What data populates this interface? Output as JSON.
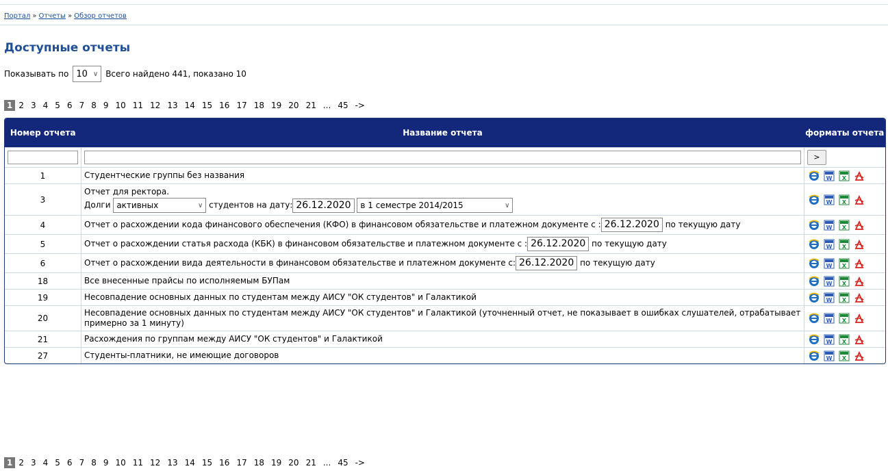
{
  "breadcrumb": [
    "Портал",
    "Отчеты",
    "Обзор отчетов"
  ],
  "breadcrumb_sep": "»",
  "page_title": "Доступные отчеты",
  "show_label": "Показывать по",
  "page_size": "10",
  "total_text": "Всего найдено 441, показано 10",
  "pager": {
    "current": "1",
    "pages": [
      "2",
      "3",
      "4",
      "5",
      "6",
      "7",
      "8",
      "9",
      "10",
      "11",
      "12",
      "13",
      "14",
      "15",
      "16",
      "17",
      "18",
      "19",
      "20",
      "21"
    ],
    "ellipsis": "...",
    "last": "45",
    "next": "->"
  },
  "table": {
    "headers": {
      "num": "Номер отчета",
      "name": "Название отчета",
      "formats": "форматы отчета"
    },
    "filter_go": ">",
    "rows": [
      {
        "num": "1",
        "name": "Студентческие группы без названия"
      },
      {
        "num": "3",
        "line1": "Отчет для ректора.",
        "pre": "Долги",
        "status": "активных",
        "mid": "студентов на дату:",
        "date": "26.12.2020",
        "semester": "в 1 семестре 2014/2015"
      },
      {
        "num": "4",
        "pre": "Отчет о расхождении кода финансового обеспечения (КФО) в финансовом обязательстве и платежном документе с :",
        "date": "26.12.2020",
        "post": "по текущую дату"
      },
      {
        "num": "5",
        "pre": "Отчет о расхождении статья расхода (КБК) в финансовом обязательстве и платежном документе с :",
        "date": "26.12.2020",
        "post": "по текущую дату"
      },
      {
        "num": "6",
        "pre": "Отчет о расхождении вида деятельности в финансовом обязательстве и платежном документе с:",
        "date": "26.12.2020",
        "post": "по текущую дату"
      },
      {
        "num": "18",
        "name": "Все внесенные прайсы по исполняемым БУПам"
      },
      {
        "num": "19",
        "name": "Несовпадение основных данных по студентам между АИСУ \"ОК студентов\" и Галактикой"
      },
      {
        "num": "20",
        "name": "Несовпадение основных данных по студентам между АИСУ \"ОК студентов\" и Галактикой (уточненный отчет, не показывает в ошибках слушателей, отрабатывает примерно за 1 минуту)"
      },
      {
        "num": "21",
        "name": "Расхождения по группам между АИСУ \"ОК студентов\" и Галактикой"
      },
      {
        "num": "27",
        "name": "Студенты-платники, не имеющие договоров"
      }
    ]
  },
  "format_icons": [
    "ie-icon",
    "word-icon",
    "excel-icon",
    "pdf-icon"
  ]
}
